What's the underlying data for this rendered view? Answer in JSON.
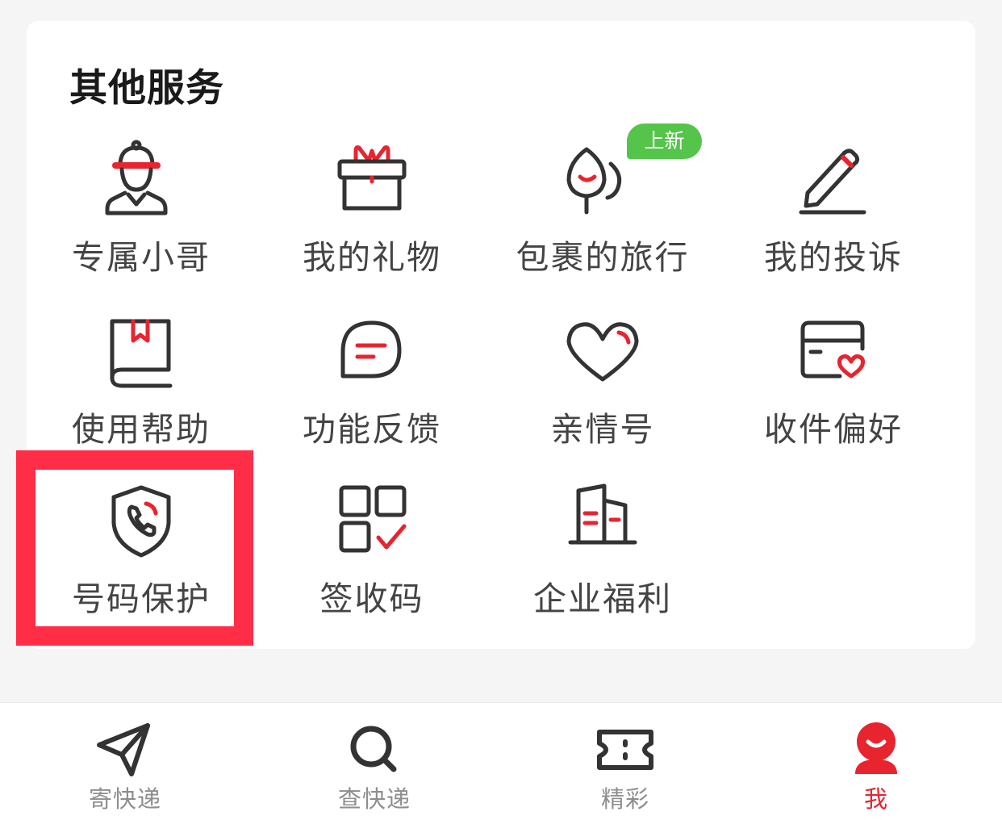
{
  "section": {
    "title": "其他服务"
  },
  "services": [
    {
      "label": "专属小哥",
      "icon": "courier-icon"
    },
    {
      "label": "我的礼物",
      "icon": "gift-icon"
    },
    {
      "label": "包裹的旅行",
      "icon": "travel-icon",
      "badge": "上新"
    },
    {
      "label": "我的投诉",
      "icon": "pen-icon"
    },
    {
      "label": "使用帮助",
      "icon": "book-icon"
    },
    {
      "label": "功能反馈",
      "icon": "chat-icon"
    },
    {
      "label": "亲情号",
      "icon": "heart-icon"
    },
    {
      "label": "收件偏好",
      "icon": "card-heart-icon"
    },
    {
      "label": "号码保护",
      "icon": "shield-phone-icon"
    },
    {
      "label": "签收码",
      "icon": "code-check-icon"
    },
    {
      "label": "企业福利",
      "icon": "building-icon"
    }
  ],
  "tabs": [
    {
      "label": "寄快递",
      "icon": "send-icon"
    },
    {
      "label": "查快递",
      "icon": "search-icon"
    },
    {
      "label": "精彩",
      "icon": "ticket-icon"
    },
    {
      "label": "我",
      "icon": "user-icon",
      "active": true
    }
  ],
  "colors": {
    "accent": "#e8242f",
    "badge": "#55c44a",
    "highlight": "#ff2d46",
    "icon": "#333333"
  }
}
